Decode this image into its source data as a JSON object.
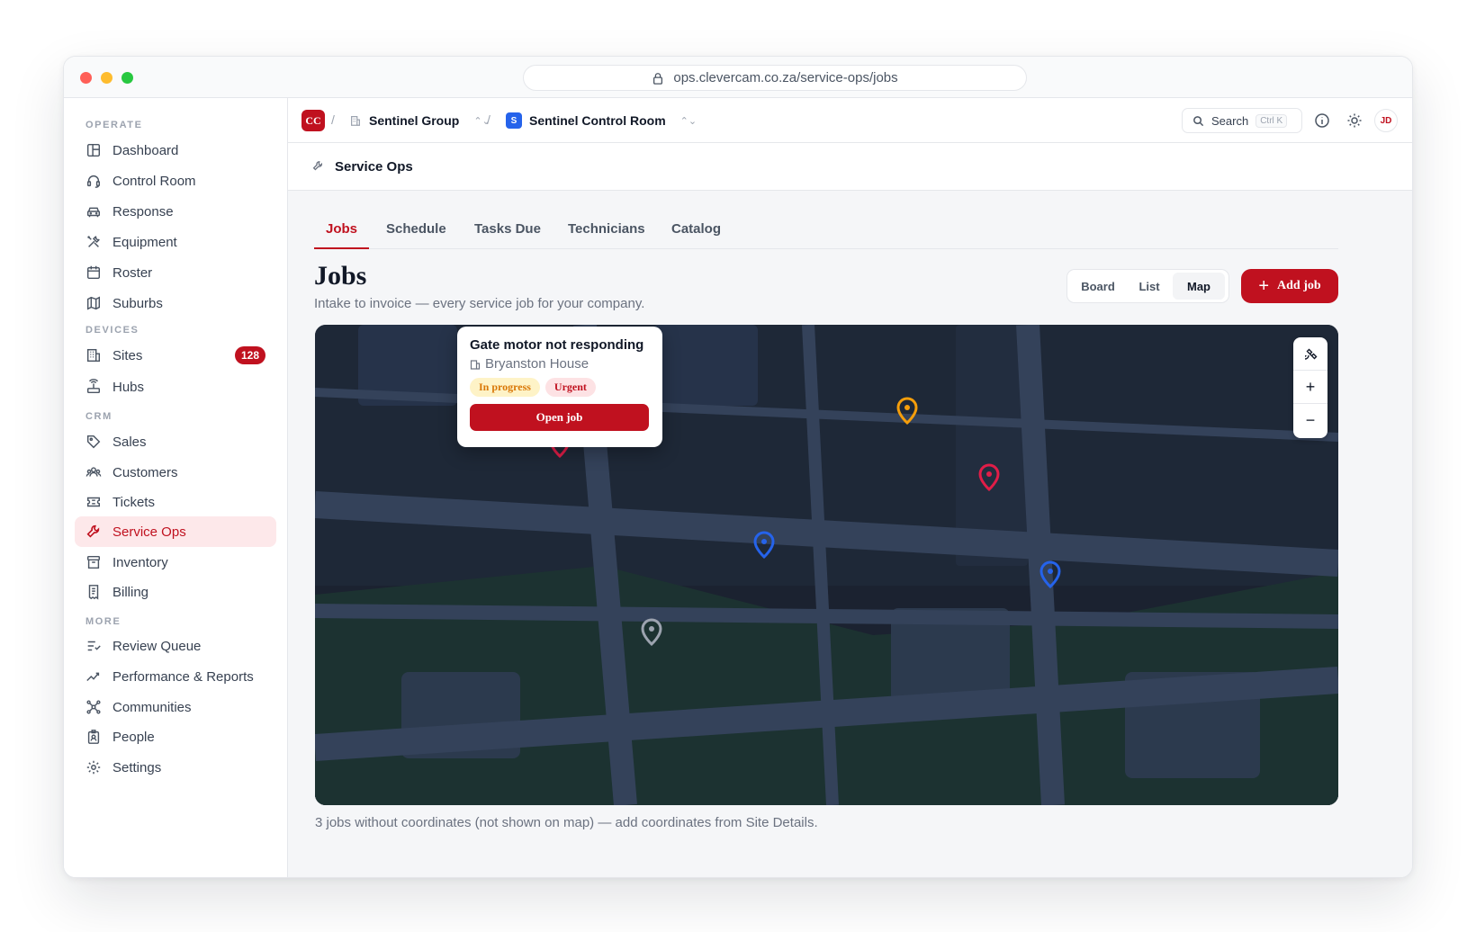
{
  "browser": {
    "url": "ops.clevercam.co.za/service-ops/jobs"
  },
  "sidebar": {
    "sections": {
      "operate": "OPERATE",
      "devices": "DEVICES",
      "crm": "CRM",
      "more": "MORE"
    },
    "items": {
      "dashboard": "Dashboard",
      "control_room": "Control Room",
      "response": "Response",
      "equipment": "Equipment",
      "roster": "Roster",
      "suburbs": "Suburbs",
      "sites": "Sites",
      "sites_count": "128",
      "hubs": "Hubs",
      "sales": "Sales",
      "customers": "Customers",
      "tickets": "Tickets",
      "service_ops": "Service Ops",
      "inventory": "Inventory",
      "billing": "Billing",
      "review_queue": "Review Queue",
      "performance": "Performance & Reports",
      "communities": "Communities",
      "people": "People",
      "settings": "Settings"
    }
  },
  "topbar": {
    "logo": "CC",
    "org": "Sentinel Group",
    "workspace_badge": "S",
    "workspace": "Sentinel Control Room",
    "search_label": "Search",
    "search_shortcut": "Ctrl K",
    "avatar": "JD"
  },
  "page": {
    "section_title": "Service Ops",
    "tabs": {
      "jobs": "Jobs",
      "schedule": "Schedule",
      "tasks_due": "Tasks Due",
      "technicians": "Technicians",
      "catalog": "Catalog"
    },
    "title": "Jobs",
    "subtitle": "Intake to invoice — every service job for your company.",
    "views": {
      "board": "Board",
      "list": "List",
      "map": "Map",
      "selected": "Map"
    },
    "add_job": "Add job"
  },
  "map": {
    "popup": {
      "title": "Gate motor not responding",
      "site": "Bryanston House",
      "status": "In progress",
      "priority": "Urgent",
      "open_button": "Open job"
    },
    "controls": {
      "zoom_in": "+",
      "zoom_out": "−"
    },
    "pin_colors": {
      "amber": "#f59e0b",
      "red": "#e11d48",
      "blue": "#2563eb",
      "gray": "#9ca3af"
    },
    "footnote": "3 jobs without coordinates (not shown on map) — add coordinates from Site Details."
  }
}
